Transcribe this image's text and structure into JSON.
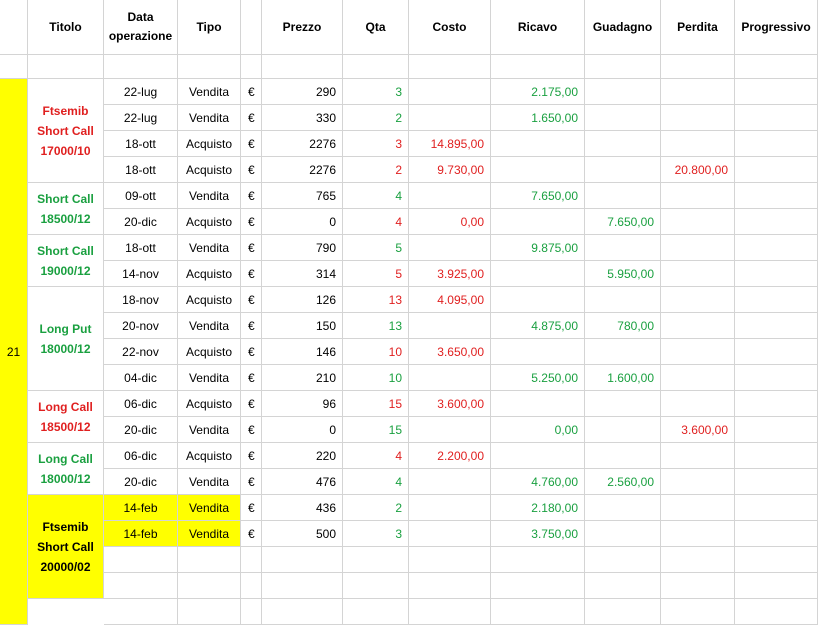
{
  "headers": {
    "titolo": "Titolo",
    "data_op": "Data operazione",
    "tipo": "Tipo",
    "prezzo": "Prezzo",
    "qta": "Qta",
    "costo": "Costo",
    "ricavo": "Ricavo",
    "guadagno": "Guadagno",
    "perdita": "Perdita",
    "progressivo": "Progressivo"
  },
  "side_number": "21",
  "colors": {
    "red": "#e02020",
    "green": "#1aa040",
    "highlight": "#ffff00",
    "grid": "#d4d4d4"
  },
  "titles": [
    {
      "text": "Ftsemib Short Call 17000/10",
      "color": "red",
      "rows": [
        0,
        3
      ]
    },
    {
      "text": "Short Call 18500/12",
      "color": "green",
      "rows": [
        4,
        5
      ]
    },
    {
      "text": "Short Call 19000/12",
      "color": "green",
      "rows": [
        6,
        7
      ]
    },
    {
      "text": "Long Put 18000/12",
      "color": "green",
      "rows": [
        8,
        11
      ]
    },
    {
      "text": "Long Call 18500/12",
      "color": "red",
      "rows": [
        12,
        13
      ]
    },
    {
      "text": "Long Call 18000/12",
      "color": "green",
      "rows": [
        14,
        15
      ]
    },
    {
      "text": "Ftsemib Short Call 20000/02",
      "color": "black",
      "rows": [
        16,
        19
      ],
      "highlight": true
    }
  ],
  "rows": [
    {
      "date": "22-lug",
      "tipo": "Vendita",
      "cur": "€",
      "prezzo": "290",
      "qta": "3",
      "qta_color": "green",
      "costo": "",
      "ricavo": "2.175,00",
      "guadagno": "",
      "perdita": "",
      "progressivo": ""
    },
    {
      "date": "22-lug",
      "tipo": "Vendita",
      "cur": "€",
      "prezzo": "330",
      "qta": "2",
      "qta_color": "green",
      "costo": "",
      "ricavo": "1.650,00",
      "guadagno": "",
      "perdita": "",
      "progressivo": ""
    },
    {
      "date": "18-ott",
      "tipo": "Acquisto",
      "cur": "€",
      "prezzo": "2276",
      "qta": "3",
      "qta_color": "red",
      "costo": "14.895,00",
      "ricavo": "",
      "guadagno": "",
      "perdita": "",
      "progressivo": ""
    },
    {
      "date": "18-ott",
      "tipo": "Acquisto",
      "cur": "€",
      "prezzo": "2276",
      "qta": "2",
      "qta_color": "red",
      "costo": "9.730,00",
      "ricavo": "",
      "guadagno": "",
      "perdita": "20.800,00",
      "progressivo": ""
    },
    {
      "date": "09-ott",
      "tipo": "Vendita",
      "cur": "€",
      "prezzo": "765",
      "qta": "4",
      "qta_color": "green",
      "costo": "",
      "ricavo": "7.650,00",
      "guadagno": "",
      "perdita": "",
      "progressivo": ""
    },
    {
      "date": "20-dic",
      "tipo": "Acquisto",
      "cur": "€",
      "prezzo": "0",
      "qta": "4",
      "qta_color": "red",
      "costo": "0,00",
      "ricavo": "",
      "guadagno": "7.650,00",
      "perdita": "",
      "progressivo": ""
    },
    {
      "date": "18-ott",
      "tipo": "Vendita",
      "cur": "€",
      "prezzo": "790",
      "qta": "5",
      "qta_color": "green",
      "costo": "",
      "ricavo": "9.875,00",
      "guadagno": "",
      "perdita": "",
      "progressivo": ""
    },
    {
      "date": "14-nov",
      "tipo": "Acquisto",
      "cur": "€",
      "prezzo": "314",
      "qta": "5",
      "qta_color": "red",
      "costo": "3.925,00",
      "ricavo": "",
      "guadagno": "5.950,00",
      "perdita": "",
      "progressivo": ""
    },
    {
      "date": "18-nov",
      "tipo": "Acquisto",
      "cur": "€",
      "prezzo": "126",
      "qta": "13",
      "qta_color": "red",
      "costo": "4.095,00",
      "ricavo": "",
      "guadagno": "",
      "perdita": "",
      "progressivo": ""
    },
    {
      "date": "20-nov",
      "tipo": "Vendita",
      "cur": "€",
      "prezzo": "150",
      "qta": "13",
      "qta_color": "green",
      "costo": "",
      "ricavo": "4.875,00",
      "guadagno": "780,00",
      "perdita": "",
      "progressivo": ""
    },
    {
      "date": "22-nov",
      "tipo": "Acquisto",
      "cur": "€",
      "prezzo": "146",
      "qta": "10",
      "qta_color": "red",
      "costo": "3.650,00",
      "ricavo": "",
      "guadagno": "",
      "perdita": "",
      "progressivo": ""
    },
    {
      "date": "04-dic",
      "tipo": "Vendita",
      "cur": "€",
      "prezzo": "210",
      "qta": "10",
      "qta_color": "green",
      "costo": "",
      "ricavo": "5.250,00",
      "guadagno": "1.600,00",
      "perdita": "",
      "progressivo": ""
    },
    {
      "date": "06-dic",
      "tipo": "Acquisto",
      "cur": "€",
      "prezzo": "96",
      "qta": "15",
      "qta_color": "red",
      "costo": "3.600,00",
      "ricavo": "",
      "guadagno": "",
      "perdita": "",
      "progressivo": ""
    },
    {
      "date": "20-dic",
      "tipo": "Vendita",
      "cur": "€",
      "prezzo": "0",
      "qta": "15",
      "qta_color": "green",
      "costo": "",
      "ricavo": "0,00",
      "guadagno": "",
      "perdita": "3.600,00",
      "progressivo": ""
    },
    {
      "date": "06-dic",
      "tipo": "Acquisto",
      "cur": "€",
      "prezzo": "220",
      "qta": "4",
      "qta_color": "red",
      "costo": "2.200,00",
      "ricavo": "",
      "guadagno": "",
      "perdita": "",
      "progressivo": ""
    },
    {
      "date": "20-dic",
      "tipo": "Vendita",
      "cur": "€",
      "prezzo": "476",
      "qta": "4",
      "qta_color": "green",
      "costo": "",
      "ricavo": "4.760,00",
      "guadagno": "2.560,00",
      "perdita": "",
      "progressivo": ""
    },
    {
      "date": "14-feb",
      "tipo": "Vendita",
      "cur": "€",
      "prezzo": "436",
      "qta": "2",
      "qta_color": "green",
      "costo": "",
      "ricavo": "2.180,00",
      "guadagno": "",
      "perdita": "",
      "progressivo": "",
      "highlight": true
    },
    {
      "date": "14-feb",
      "tipo": "Vendita",
      "cur": "€",
      "prezzo": "500",
      "qta": "3",
      "qta_color": "green",
      "costo": "",
      "ricavo": "3.750,00",
      "guadagno": "",
      "perdita": "",
      "progressivo": "",
      "highlight": true
    },
    {
      "date": "",
      "tipo": "",
      "cur": "",
      "prezzo": "",
      "qta": "",
      "qta_color": "",
      "costo": "",
      "ricavo": "",
      "guadagno": "",
      "perdita": "",
      "progressivo": ""
    },
    {
      "date": "",
      "tipo": "",
      "cur": "",
      "prezzo": "",
      "qta": "",
      "qta_color": "",
      "costo": "",
      "ricavo": "",
      "guadagno": "",
      "perdita": "",
      "progressivo": ""
    },
    {
      "date": "",
      "tipo": "",
      "cur": "",
      "prezzo": "",
      "qta": "",
      "qta_color": "",
      "costo": "",
      "ricavo": "",
      "guadagno": "",
      "perdita": "",
      "progressivo": ""
    }
  ]
}
